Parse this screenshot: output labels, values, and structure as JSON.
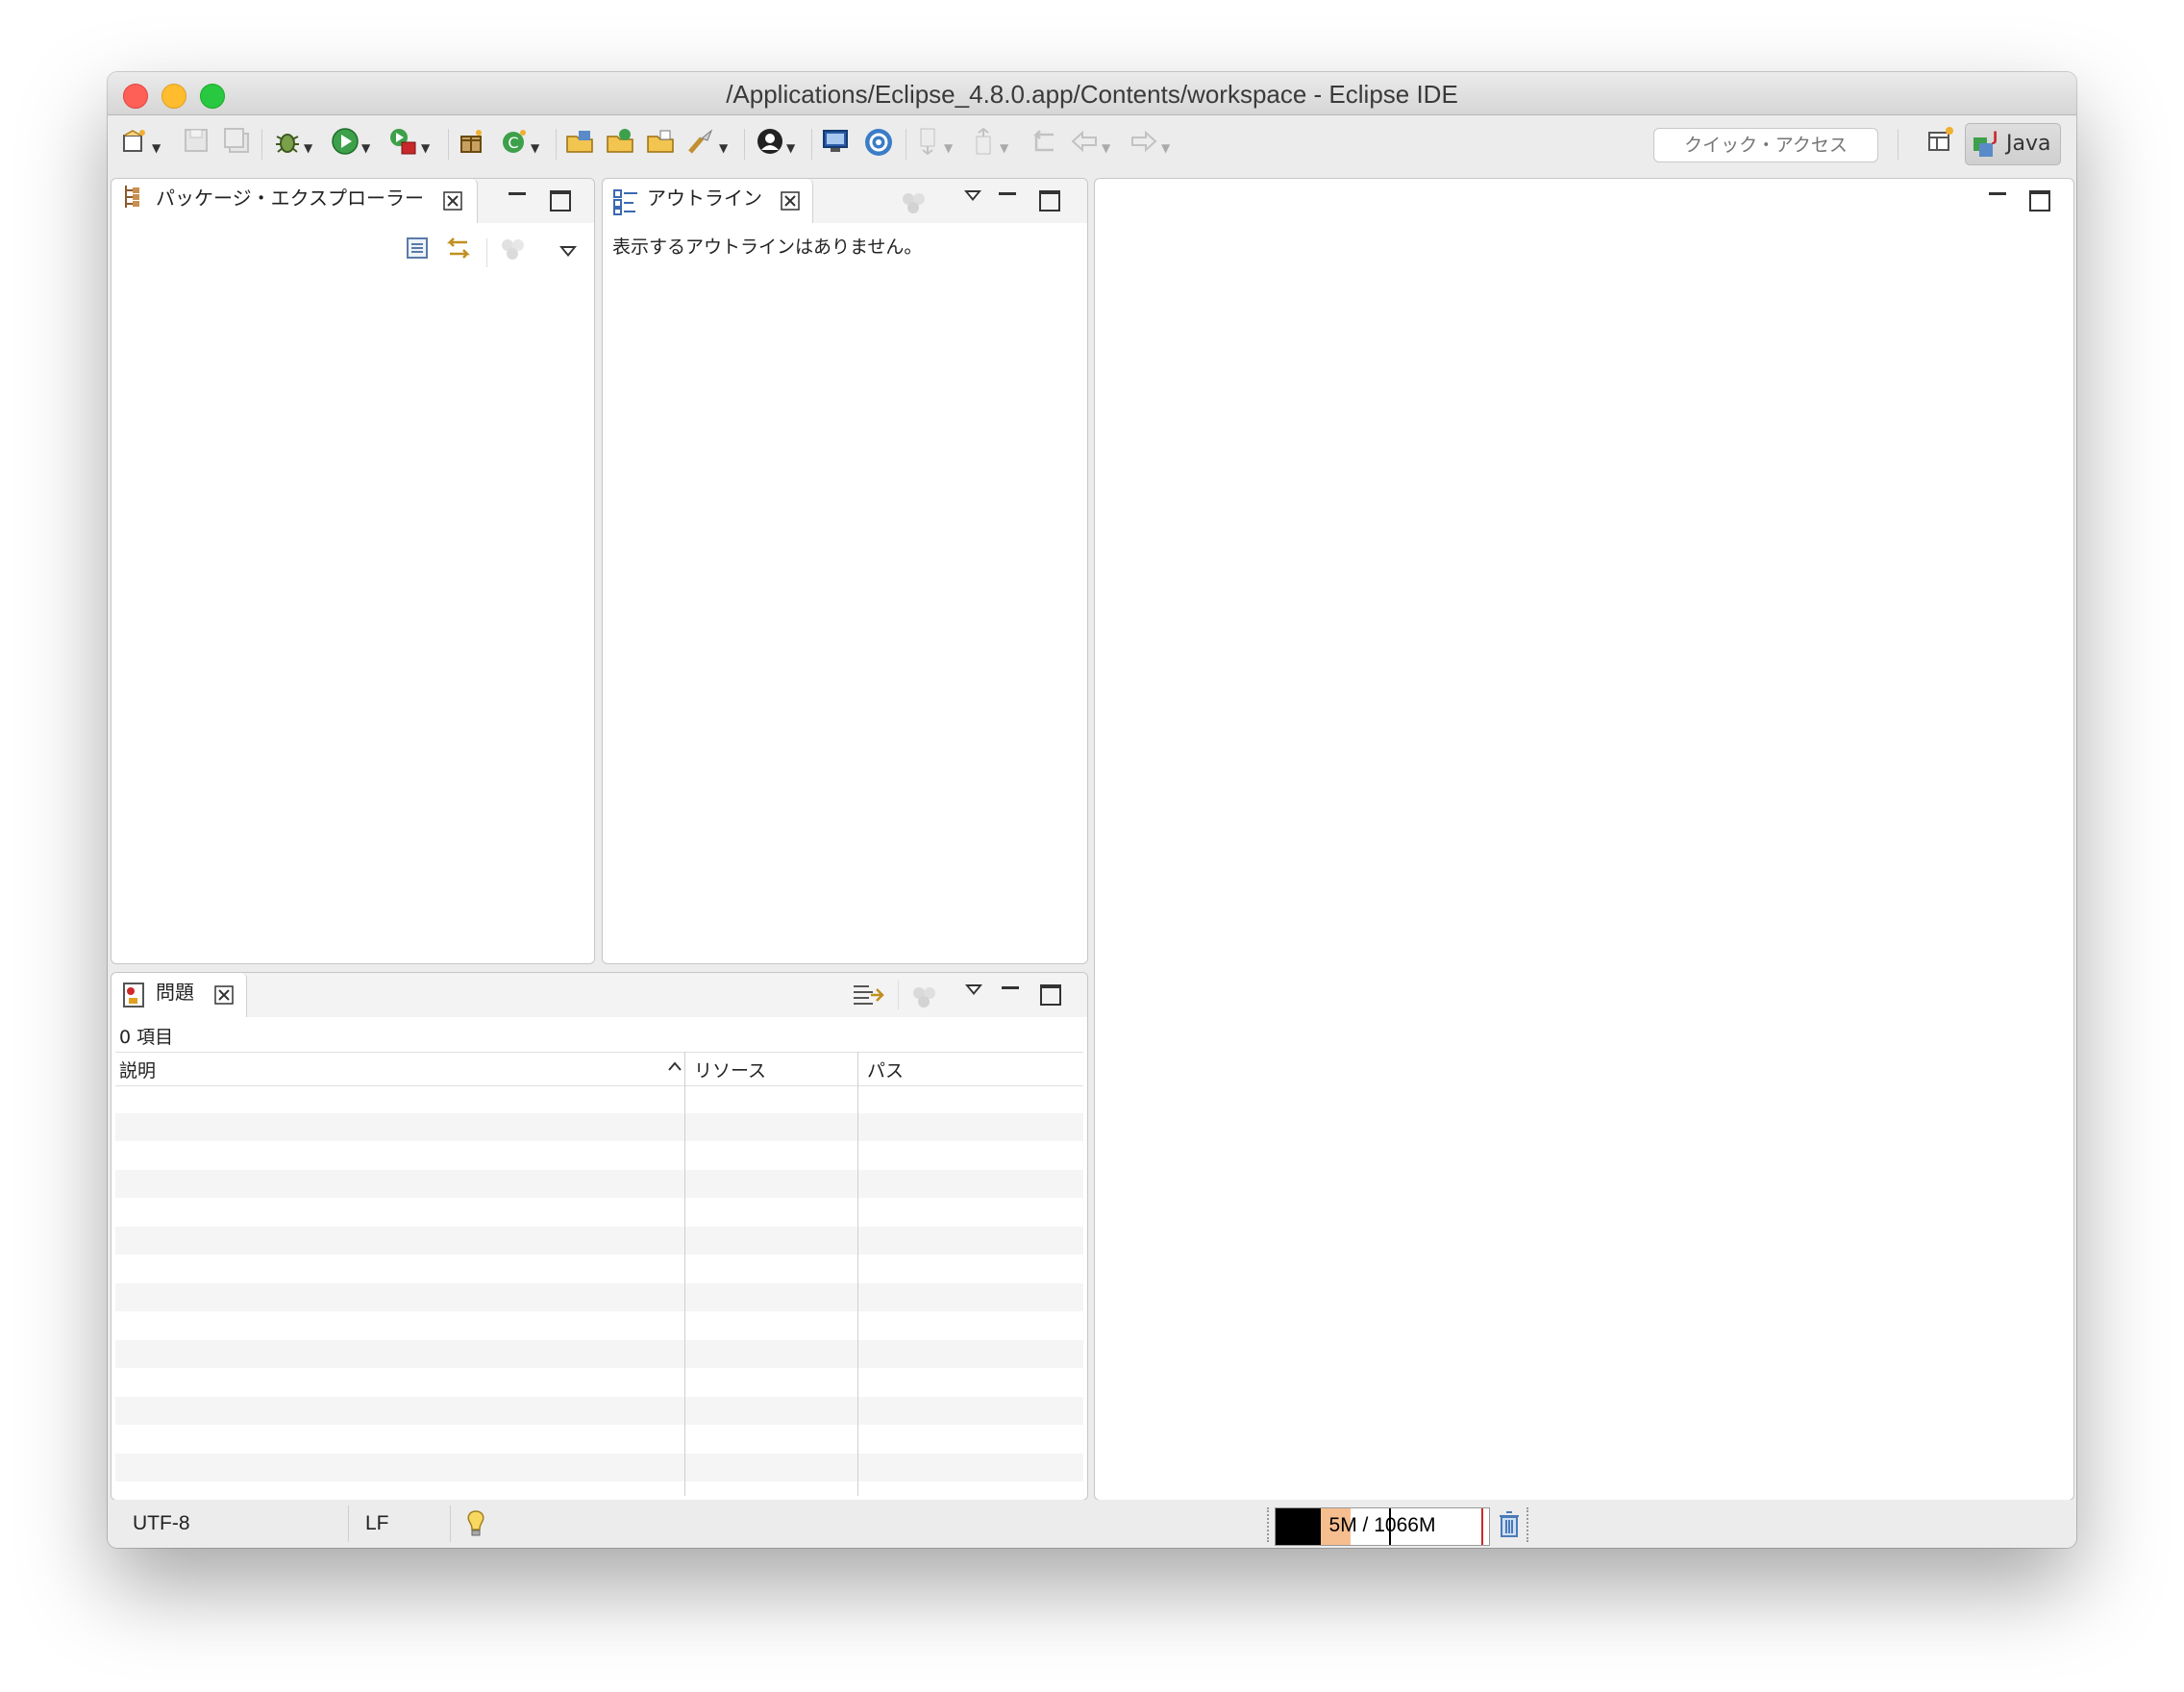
{
  "window": {
    "title": "/Applications/Eclipse_4.8.0.app/Contents/workspace - Eclipse IDE"
  },
  "toolbar": {
    "quick_access_placeholder": "クイック・アクセス",
    "perspective_label": "Java",
    "icons": [
      "new-wizard-icon",
      "save-icon",
      "save-all-icon",
      "debug-icon",
      "run-icon",
      "external-tools-icon",
      "new-java-package-icon",
      "new-java-class-icon",
      "open-type-icon",
      "open-task-icon",
      "open-resource-icon",
      "search-icon",
      "profile-icon",
      "console-icon",
      "settings-icon",
      "next-annotation-icon",
      "previous-annotation-icon",
      "last-edit-icon",
      "back-icon",
      "forward-icon",
      "open-perspective-icon"
    ]
  },
  "package_explorer": {
    "tab_label": "パッケージ・エクスプローラー"
  },
  "outline": {
    "tab_label": "アウトライン",
    "empty_message": "表示するアウトラインはありません。"
  },
  "problems": {
    "tab_label": "問題",
    "count_text": "0 項目",
    "columns": [
      "説明",
      "リソース",
      "パス"
    ]
  },
  "status_bar": {
    "encoding": "UTF-8",
    "line_delimiter": "LF",
    "heap_text": "5M / 1066M",
    "heap_used_fraction": 0.35
  }
}
